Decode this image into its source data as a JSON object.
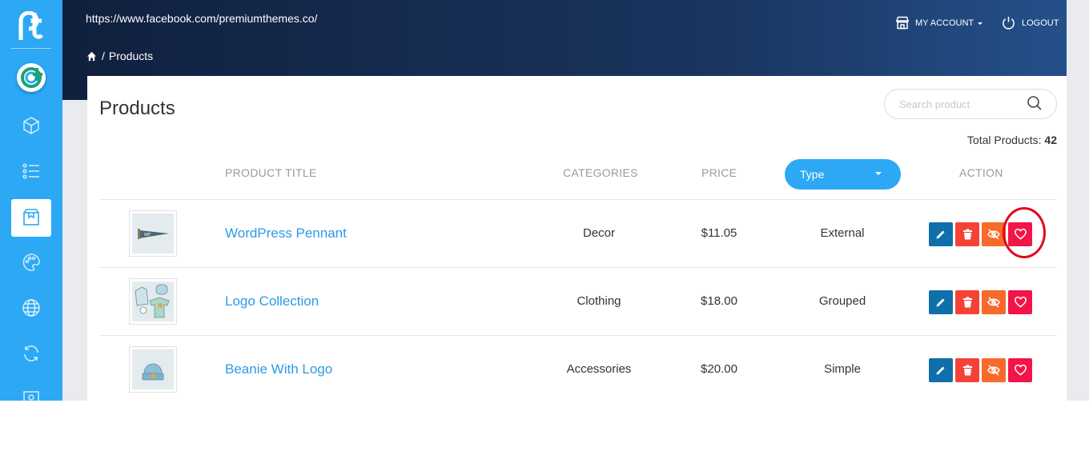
{
  "header": {
    "url": "https://www.facebook.com/premiumthemes.co/",
    "breadcrumb": {
      "separator": "/",
      "current": "Products"
    },
    "my_account": "MY ACCOUNT",
    "logout": "LOGOUT"
  },
  "sidebar": {
    "items": [
      {
        "icon": "box-icon"
      },
      {
        "icon": "list-icon"
      },
      {
        "icon": "product-icon",
        "active": true
      },
      {
        "icon": "palette-icon"
      },
      {
        "icon": "globe-icon"
      },
      {
        "icon": "sync-icon"
      },
      {
        "icon": "image-icon"
      }
    ]
  },
  "main": {
    "title": "Products",
    "search_placeholder": "Search product",
    "total_label": "Total Products:",
    "total_count": "42",
    "columns": {
      "title": "PRODUCT TITLE",
      "categories": "CATEGORIES",
      "price": "PRICE",
      "type": "Type",
      "action": "ACTION"
    },
    "products": [
      {
        "title": "WordPress Pennant",
        "category": "Decor",
        "price": "$11.05",
        "type": "External"
      },
      {
        "title": "Logo Collection",
        "category": "Clothing",
        "price": "$18.00",
        "type": "Grouped"
      },
      {
        "title": "Beanie With Logo",
        "category": "Accessories",
        "price": "$20.00",
        "type": "Simple"
      }
    ]
  },
  "colors": {
    "sidebar": "#2da8f5",
    "link": "#2d9ae6",
    "edit": "#0f6fab",
    "delete": "#f44336",
    "hide": "#f76a2b",
    "favorite": "#f2154a",
    "highlight": "#e2081b"
  }
}
